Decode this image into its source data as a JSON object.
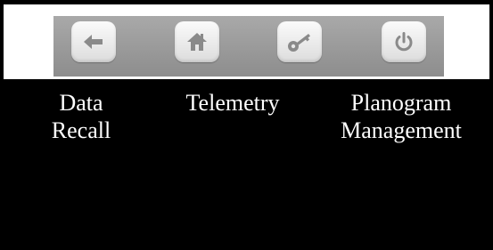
{
  "toolbar": {
    "buttons": [
      {
        "name": "back",
        "icon": "arrow-left-icon"
      },
      {
        "name": "home",
        "icon": "home-icon"
      },
      {
        "name": "key",
        "icon": "key-icon"
      },
      {
        "name": "power",
        "icon": "power-icon"
      }
    ]
  },
  "menu": {
    "items": [
      {
        "lines": [
          "Data",
          "Recall"
        ]
      },
      {
        "lines": [
          "Telemetry"
        ]
      },
      {
        "lines": [
          "Planogram",
          "Management"
        ]
      }
    ]
  },
  "colors": {
    "background": "#000000",
    "toolbar": "#9a9a9a",
    "button": "#efefef",
    "icon": "#8a8a8a",
    "text": "#ffffff"
  }
}
